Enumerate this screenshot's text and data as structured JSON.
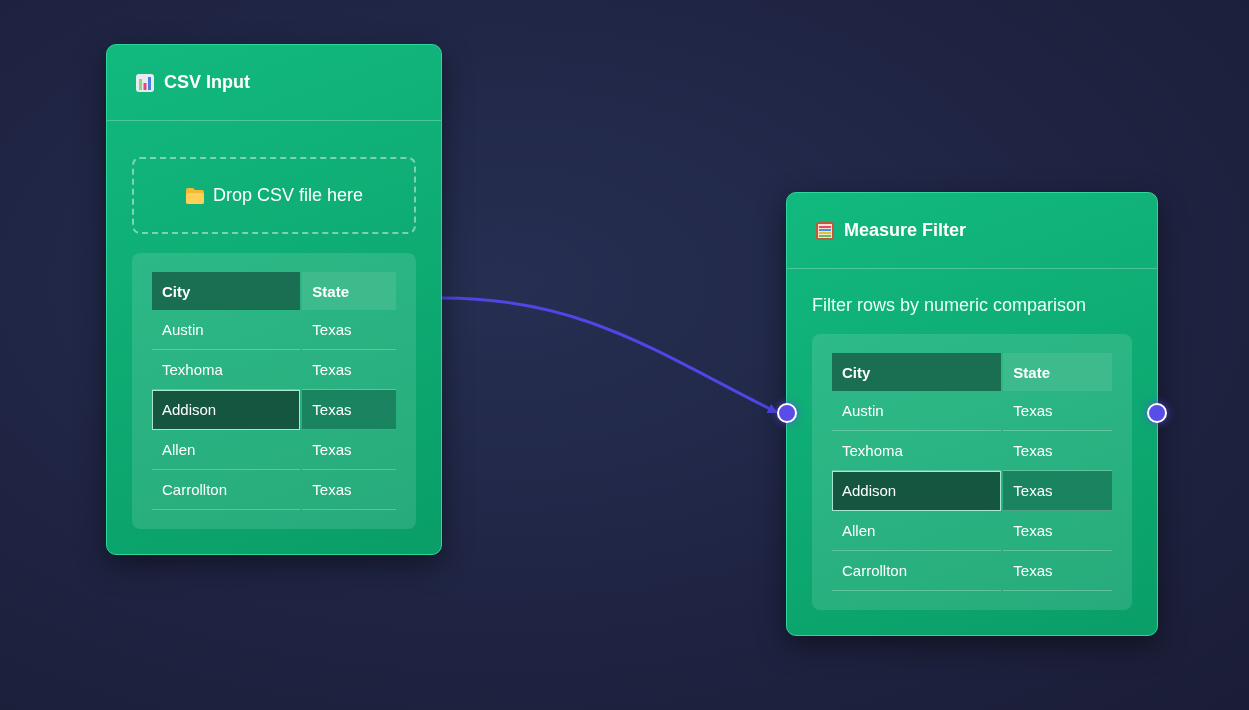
{
  "nodes": [
    {
      "kind": "input",
      "title": "CSV Input",
      "drop_zone": "Drop CSV file here",
      "table": {
        "columns": [
          {
            "label": "City",
            "selected": true
          },
          {
            "label": "State",
            "selected": false
          }
        ],
        "rows": [
          {
            "cells": [
              "Austin",
              "Texas"
            ],
            "selected": false
          },
          {
            "cells": [
              "Texhoma",
              "Texas"
            ],
            "selected": false
          },
          {
            "cells": [
              "Addison",
              "Texas"
            ],
            "selected": true
          },
          {
            "cells": [
              "Allen",
              "Texas"
            ],
            "selected": false
          },
          {
            "cells": [
              "Carrollton",
              "Texas"
            ],
            "selected": false
          }
        ]
      }
    },
    {
      "kind": "filter",
      "title": "Measure Filter",
      "description": "Filter rows by numeric comparison",
      "input_port": true,
      "output_port": true,
      "input_connected": true,
      "table": {
        "columns": [
          {
            "label": "City",
            "selected": true
          },
          {
            "label": "State",
            "selected": false
          }
        ],
        "rows": [
          {
            "cells": [
              "Austin",
              "Texas"
            ],
            "selected": false
          },
          {
            "cells": [
              "Texhoma",
              "Texas"
            ],
            "selected": false
          },
          {
            "cells": [
              "Addison",
              "Texas"
            ],
            "selected": true
          },
          {
            "cells": [
              "Allen",
              "Texas"
            ],
            "selected": false
          },
          {
            "cells": [
              "Carrollton",
              "Texas"
            ],
            "selected": false
          }
        ]
      }
    }
  ]
}
